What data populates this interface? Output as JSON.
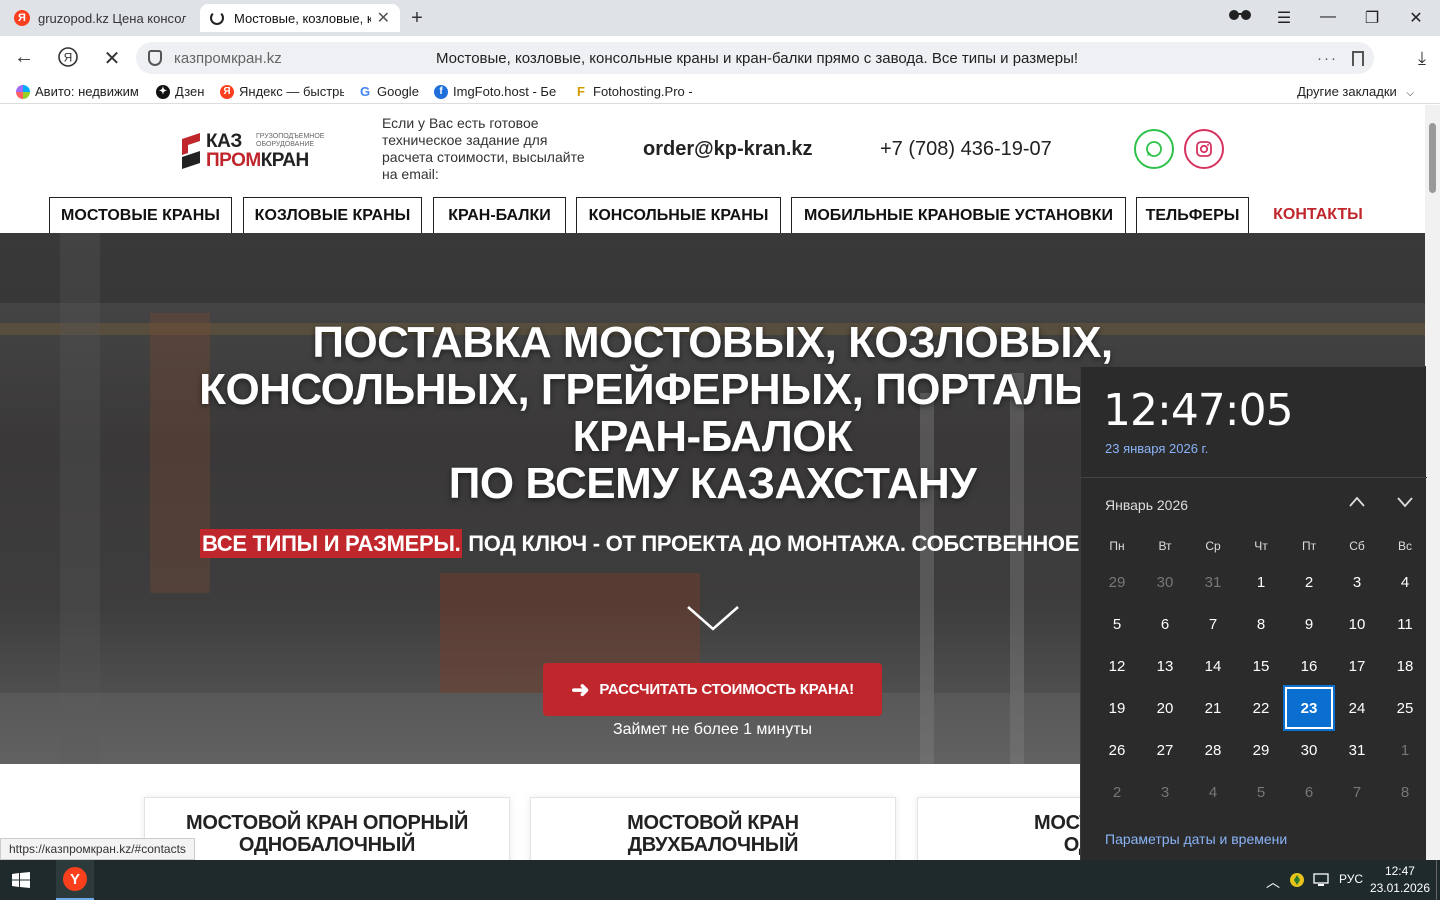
{
  "browser": {
    "tabs": [
      {
        "label": "gruzopod.kz Цена консол"
      },
      {
        "label": "Мостовые, козловые, к"
      }
    ],
    "address": {
      "domain": "казпромкран.kz",
      "page_title": "Мостовые, козловые, консольные краны и кран-балки прямо с завода. Все типы и размеры!"
    },
    "bookmarks": [
      {
        "label": "Авито: недвижим",
        "icon": "avito-icon"
      },
      {
        "label": "Дзен",
        "icon": "dzen-icon"
      },
      {
        "label": "Яндекс — быстры",
        "icon": "yandex-icon"
      },
      {
        "label": "Google",
        "icon": "google-icon"
      },
      {
        "label": "ImgFoto.host - Бе",
        "icon": "imgfoto-icon"
      },
      {
        "label": "Fotohosting.Pro - ",
        "icon": "fotohosting-icon"
      }
    ],
    "other_bookmarks": "Другие закладки",
    "status_url": "https://казпромкран.kz/#contacts"
  },
  "site": {
    "logo": {
      "kaz": "КАЗ",
      "prom": "ПРОМ",
      "kran": "КРАН",
      "sub": "ГРУЗОПОДЪЕМНОЕ ОБОРУДОВАНИЕ"
    },
    "tz_text": "Если у Вас есть готовое техническое задание для расчета стоимости, высылайте на email:",
    "email": "order@kp-kran.kz",
    "phone": "+7 (708) 436-19-07",
    "nav": [
      "МОСТОВЫЕ КРАНЫ",
      "КОЗЛОВЫЕ КРАНЫ",
      "КРАН-БАЛКИ",
      "КОНСОЛЬНЫЕ КРАНЫ",
      "МОБИЛЬНЫЕ КРАНОВЫЕ УСТАНОВКИ",
      "ТЕЛЬФЕРЫ",
      "КОНТАКТЫ"
    ],
    "hero": {
      "title_lines": [
        "ПОСТАВКА МОСТОВЫХ, КОЗЛОВЫХ,",
        "КОНСОЛЬНЫХ, ГРЕЙФЕРНЫХ, ПОРТАЛЬНЫХ К",
        "КРАН-БАЛОК",
        "ПО ВСЕМУ КАЗАХСТАНУ"
      ],
      "sub_red": "ВСЕ ТИПЫ И РАЗМЕРЫ.",
      "sub_rest": " ПОД КЛЮЧ - ОТ ПРОЕКТА ДО МОНТАЖА. СОБСТВЕННОЕ ПР",
      "cta": "РАССЧИТАТЬ СТОИМОСТЬ КРАНА!",
      "cta_note": "Займет не более 1 минуты"
    },
    "cards": [
      {
        "line1": "МОСТОВОЙ КРАН ОПОРНЫЙ",
        "line2": "ОДНОБАЛОЧНЫЙ"
      },
      {
        "line1": "МОСТОВОЙ КРАН",
        "line2": "ДВУХБАЛОЧНЫЙ"
      },
      {
        "line1": "МОСТОВОЙ К",
        "line2": "ОДНОП"
      }
    ],
    "colors": {
      "accent_red": "#c0272d",
      "whatsapp": "#2fc24a",
      "instagram": "#d6335f"
    }
  },
  "calendar": {
    "time": "12:47:05",
    "date": "23 января 2026 г.",
    "month": "Январь 2026",
    "weekdays": [
      "Пн",
      "Вт",
      "Ср",
      "Чт",
      "Пт",
      "Сб",
      "Вс"
    ],
    "weeks": [
      [
        "29",
        "30",
        "31",
        "1",
        "2",
        "3",
        "4"
      ],
      [
        "5",
        "6",
        "7",
        "8",
        "9",
        "10",
        "11"
      ],
      [
        "12",
        "13",
        "14",
        "15",
        "16",
        "17",
        "18"
      ],
      [
        "19",
        "20",
        "21",
        "22",
        "23",
        "24",
        "25"
      ],
      [
        "26",
        "27",
        "28",
        "29",
        "30",
        "31",
        "1"
      ],
      [
        "2",
        "3",
        "4",
        "5",
        "6",
        "7",
        "8"
      ]
    ],
    "today": "23",
    "settings_link": "Параметры даты и времени",
    "today_color": "#0a6fd1"
  },
  "taskbar": {
    "lang": "РУС",
    "clock_time": "12:47",
    "clock_date": "23.01.2026"
  }
}
